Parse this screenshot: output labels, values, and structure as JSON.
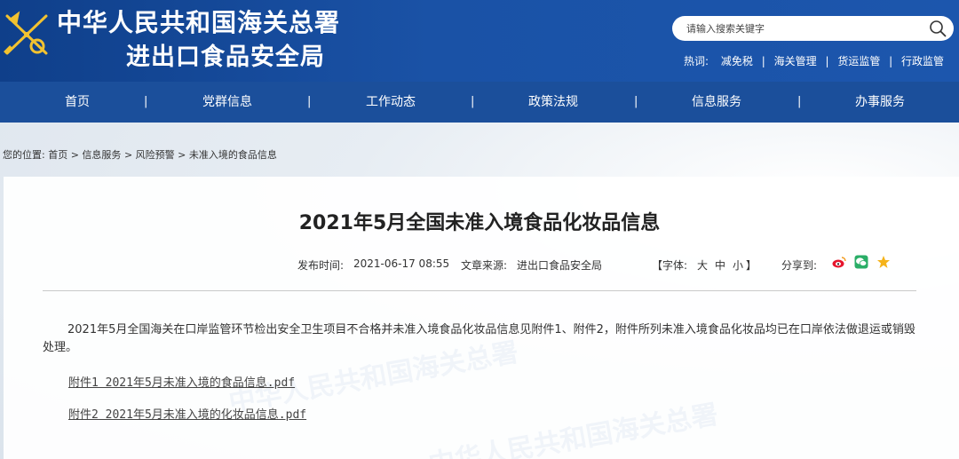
{
  "header": {
    "title": "中华人民共和国海关总署",
    "subtitle": "进出口食品安全局",
    "search_placeholder": "请输入搜索关键字",
    "hot_label": "热词:",
    "hot_words": [
      "减免税",
      "海关管理",
      "货运监管",
      "行政监管"
    ]
  },
  "nav": {
    "items": [
      "首页",
      "党群信息",
      "工作动态",
      "政策法规",
      "信息服务",
      "办事服务"
    ],
    "separator": "|"
  },
  "breadcrumb": {
    "prefix": "您的位置:",
    "items": [
      "首页",
      "信息服务",
      "风险预警",
      "未准入境的食品信息"
    ],
    "separator": ">"
  },
  "article": {
    "title": "2021年5月全国未准入境食品化妆品信息",
    "publish_label": "发布时间:",
    "publish_time": "2021-06-17 08:55",
    "source_label": "文章来源:",
    "source": "进出口食品安全局",
    "font_label": "【字体:",
    "font_large": "大",
    "font_medium": "中",
    "font_small": "小",
    "font_close": "】",
    "share_label": "分享到:",
    "body": "2021年5月全国海关在口岸监管环节检出安全卫生项目不合格并未准入境食品化妆品信息见附件1、附件2，附件所列未准入境食品化妆品均已在口岸依法做退运或销毁处理。",
    "attachments": [
      "附件1 2021年5月未准入境的食品信息.pdf",
      "附件2 2021年5月未准入境的化妆品信息.pdf"
    ]
  },
  "colors": {
    "header_bg": "#1a52a6",
    "nav_bg": "#1b4f9b"
  }
}
